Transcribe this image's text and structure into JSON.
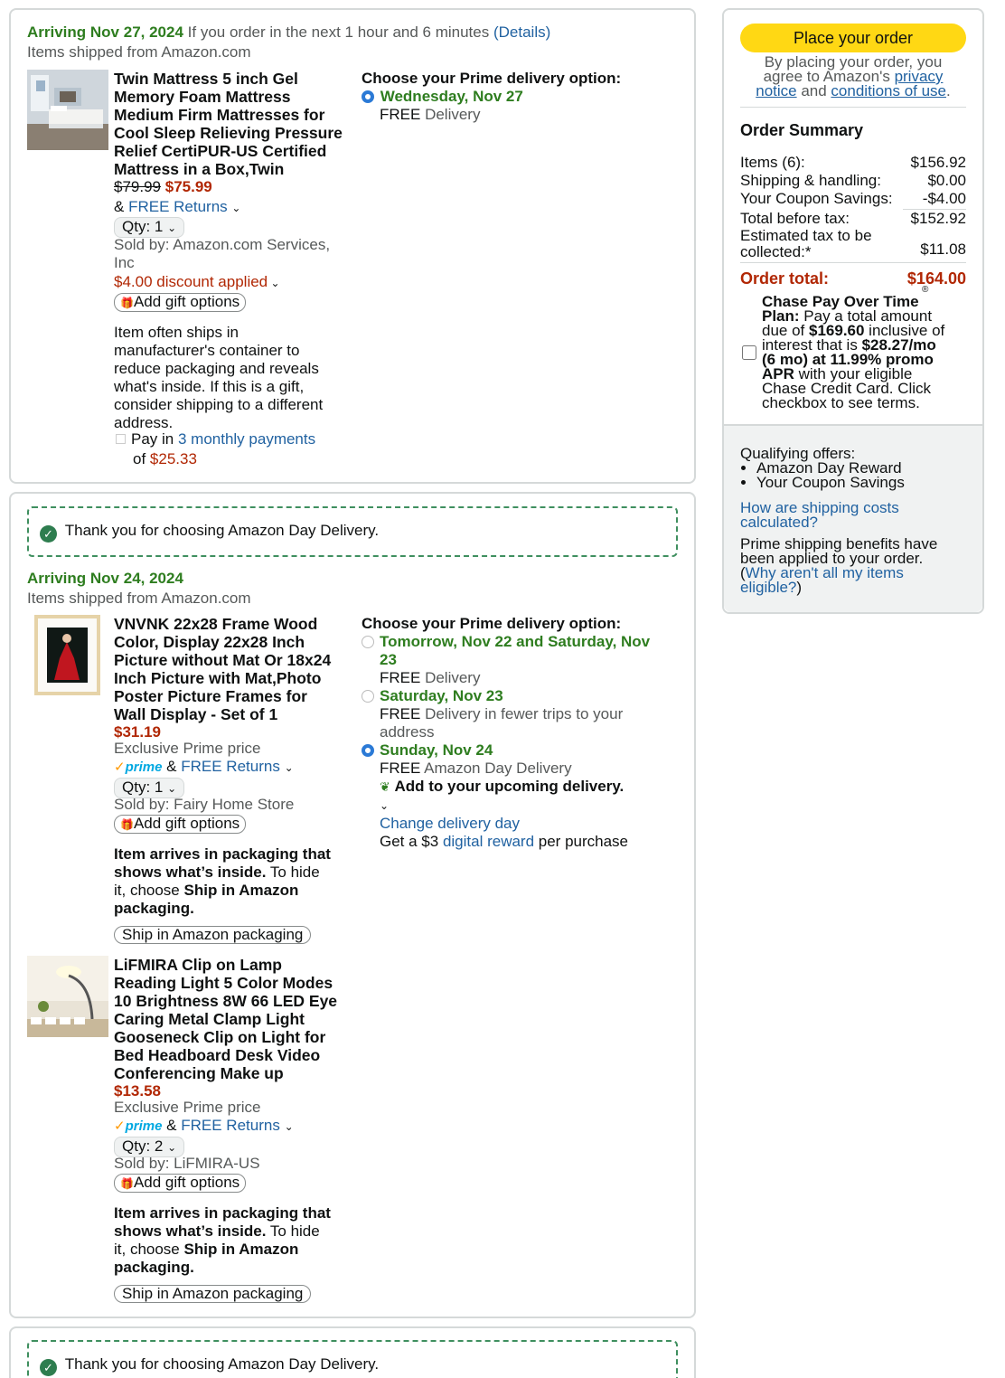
{
  "group1": {
    "arrival": "Arriving Nov 27, 2024",
    "arrival_note": " If you order in the next 1 hour and 6 minutes ",
    "details_link": "(Details)",
    "shipped_from": "Items shipped from Amazon.com",
    "item": {
      "title_lines": [
        "Twin Mattress 5 inch Gel",
        "Memory Foam Mattress",
        "Medium Firm Mattresses for",
        "Cool Sleep Relieving Pressure",
        "Relief CertiPUR-US Certified",
        "Mattress in a Box,Twin"
      ],
      "old_price": "$79.99",
      "price": "$75.99",
      "returns_prefix": "& ",
      "returns": "FREE Returns",
      "qty": "Qty: 1",
      "sold_by_lines": [
        "Sold by: Amazon.com Services,",
        "Inc"
      ],
      "discount": "$4.00 discount applied",
      "gift": "Add gift options",
      "note_lines": [
        "Item often ships in",
        "manufacturer's container to",
        "reduce packaging and reveals",
        "what's inside. If this is a gift,",
        "consider shipping to a different",
        "address."
      ],
      "pay_prefix": "Pay in ",
      "pay_link": "3 monthly payments",
      "pay_of": "of ",
      "pay_amount": "$25.33"
    },
    "delivery_heading": "Choose your Prime delivery option:",
    "options": [
      {
        "date": "Wednesday, Nov 27",
        "free": "FREE",
        "desc": " Delivery",
        "selected": true
      }
    ]
  },
  "group2": {
    "thanks": "Thank you for choosing Amazon Day Delivery.",
    "arrival": "Arriving Nov 24, 2024",
    "shipped_from": "Items shipped from Amazon.com",
    "delivery_heading": "Choose your Prime delivery option:",
    "options": [
      {
        "date_lines": [
          "Tomorrow, Nov 22 and Saturday, Nov",
          "23"
        ],
        "free": "FREE",
        "desc": " Delivery",
        "selected": false
      },
      {
        "date_lines": [
          "Saturday, Nov 23"
        ],
        "free": "FREE",
        "desc_lines": [
          " Delivery in fewer trips to your",
          "address"
        ],
        "selected": false
      },
      {
        "date_lines": [
          "Sunday, Nov 24"
        ],
        "free": "FREE",
        "desc": " Amazon Day Delivery",
        "selected": true
      }
    ],
    "upcoming": "Add to your upcoming delivery.",
    "change_day": "Change delivery day",
    "reward_prefix": "Get a $3 ",
    "reward_link": "digital reward",
    "reward_suffix": " per purchase",
    "items": [
      {
        "title_lines": [
          "VNVNK 22x28 Frame Wood",
          "Color, Display 22x28 Inch",
          "Picture without Mat Or 18x24",
          "Inch Picture with Mat,Photo",
          "Poster Picture Frames for",
          "Wall Display - Set of 1"
        ],
        "price": "$31.19",
        "exclusive": "Exclusive Prime price",
        "prime": "prime",
        "returns_prefix": " & ",
        "returns": "FREE Returns",
        "qty": "Qty: 1",
        "sold_by": "Sold by: Fairy Home Store",
        "gift": "Add gift options",
        "pkg_bold1": "Item arrives in packaging that",
        "pkg_bold2": "shows what’s inside.",
        "pkg_rest1": " To hide",
        "pkg_rest2": "it, choose ",
        "pkg_bold3": "Ship in Amazon",
        "pkg_bold4": "packaging.",
        "ship_btn": "Ship in Amazon packaging"
      },
      {
        "title_lines": [
          "LiFMIRA Clip on Lamp",
          "Reading Light 5 Color Modes",
          "10 Brightness 8W 66 LED Eye",
          "Caring Metal Clamp Light",
          "Gooseneck Clip on Light for",
          "Bed Headboard Desk Video",
          "Conferencing Make up"
        ],
        "price": "$13.58",
        "exclusive": "Exclusive Prime price",
        "prime": "prime",
        "returns_prefix": " & ",
        "returns": "FREE Returns",
        "qty": "Qty: 2",
        "sold_by": "Sold by: LiFMIRA-US",
        "gift": "Add gift options",
        "pkg_bold1": "Item arrives in packaging that",
        "pkg_bold2": "shows what’s inside.",
        "pkg_rest1": " To hide",
        "pkg_rest2": "it, choose ",
        "pkg_bold3": "Ship in Amazon",
        "pkg_bold4": "packaging.",
        "ship_btn": "Ship in Amazon packaging"
      }
    ]
  },
  "group3": {
    "thanks": "Thank you for choosing Amazon Day Delivery."
  },
  "sidebar": {
    "place_order": "Place your order",
    "agree_line1": "By placing your order, you",
    "agree_line2a": "agree to Amazon's ",
    "privacy1": "privacy",
    "privacy2": "notice",
    "and": " and ",
    "conditions": "conditions of use",
    "period": ".",
    "summary_title": "Order Summary",
    "rows": [
      {
        "label": "Items (6):",
        "value": "$156.92"
      },
      {
        "label": "Shipping & handling:",
        "value": "$0.00"
      },
      {
        "label": "Your Coupon Savings:",
        "value": "-$4.00"
      },
      {
        "label": "Total before tax:",
        "value": "$152.92"
      }
    ],
    "tax_label1": "Estimated tax to be",
    "tax_label2": "collected:*",
    "tax_value": "$11.08",
    "total_label": "Order total:",
    "total_value": "$164.00",
    "chase_lines": [
      {
        "b": "Chase Pay Over Time",
        "t": ""
      },
      {
        "b": "Plan:",
        "t": " Pay a total amount"
      },
      {
        "t1": "due of ",
        "b": "$169.60",
        "t": " inclusive of"
      },
      {
        "t1": "interest that is ",
        "b": "$28.27/mo",
        "t": ""
      },
      {
        "b": "(6 mo) at 11.99% promo",
        "t": ""
      },
      {
        "b": "APR",
        "t": " with your eligible"
      },
      {
        "t": "Chase Credit Card. Click"
      },
      {
        "t": "checkbox to see terms."
      }
    ],
    "reg": "®",
    "qualifying": "Qualifying offers:",
    "offers": [
      "Amazon Day Reward",
      "Your Coupon Savings"
    ],
    "shipping_link1": "How are shipping costs",
    "shipping_link2": "calculated?",
    "prime_text1": "Prime shipping benefits have",
    "prime_text2": "been applied to your order.",
    "paren_open": "(",
    "why_link1": "Why aren't all my items",
    "why_link2": "eligible?",
    "paren_close": ")"
  }
}
